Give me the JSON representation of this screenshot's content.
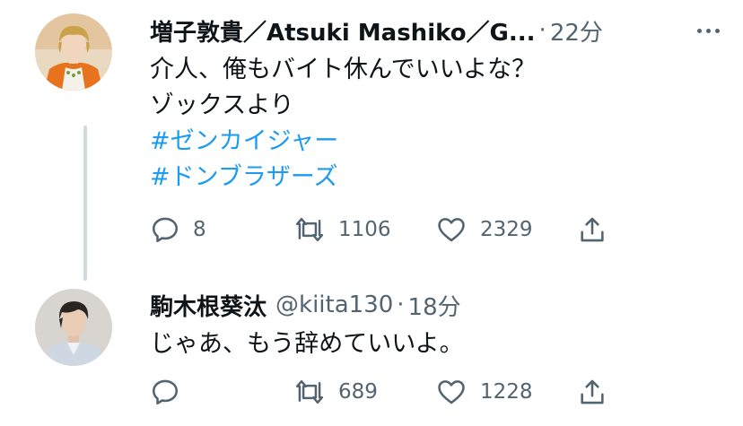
{
  "tweets": [
    {
      "display_name": "増子敦貴／Atsuki Mashiko／G...",
      "handle": "",
      "separator": "·",
      "time": "22分",
      "lines": [
        "介人、俺もバイト休んでいいよな？",
        "ゾックスより"
      ],
      "hashtags": [
        "#ゼンカイジャー",
        "#ドンブラザーズ"
      ],
      "replies": "8",
      "retweets": "1106",
      "likes": "2329",
      "avatar_colors": {
        "bg": "#e9d9c0",
        "accent": "#e8731f",
        "hair": "#c9a24a",
        "skin": "#f2d5bd"
      }
    },
    {
      "display_name": "駒木根葵汰",
      "handle": "@kiita130",
      "separator": "·",
      "time": "18分",
      "lines": [
        "じゃあ、もう辞めていいよ。"
      ],
      "hashtags": [],
      "replies": "",
      "retweets": "689",
      "likes": "1228",
      "avatar_colors": {
        "bg": "#d8d4cf",
        "accent": "#cfd7e3",
        "hair": "#2b2522",
        "skin": "#e9cdb6"
      }
    }
  ],
  "icons": {
    "reply": "reply-icon",
    "retweet": "retweet-icon",
    "like": "like-icon",
    "share": "share-icon",
    "more": "more-icon"
  },
  "colors": {
    "text": "#0f1419",
    "secondary": "#536471",
    "hashtag": "#1d9bf0",
    "thread_line": "#cfd9de"
  }
}
